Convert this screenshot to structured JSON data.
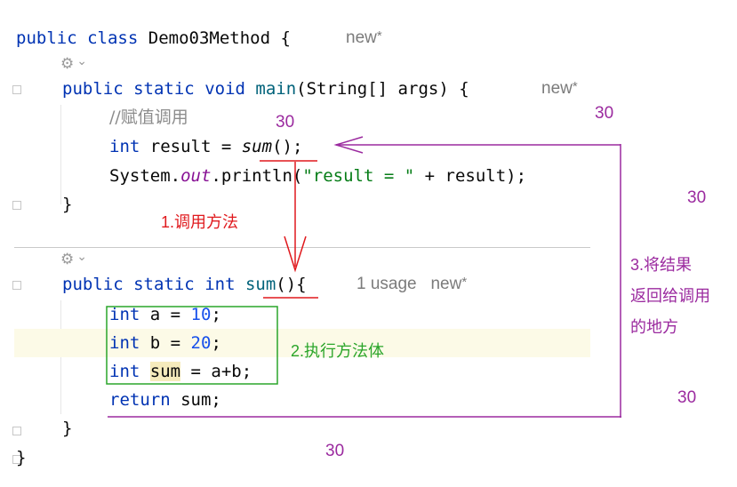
{
  "code": {
    "class_decl": {
      "public": "public",
      "class": "class",
      "name": "Demo03Method",
      "brace": "{"
    },
    "class_hint": {
      "text": "new",
      "star": "*"
    },
    "main_decl": {
      "public": "public",
      "static": "static",
      "void": "void",
      "name": "main",
      "params": "(String[] args)",
      "brace": "{"
    },
    "main_hint": {
      "text": "new",
      "star": "*"
    },
    "comment": "//赋值调用",
    "assign_line": {
      "type": "int",
      "rest1": "result = ",
      "call": "sum",
      "rest2": "();"
    },
    "println_line": {
      "cls": "System.",
      "field": "out",
      "method": ".println(",
      "str": "\"result = \"",
      "rest": " + result);"
    },
    "main_close": "}",
    "sum_decl": {
      "public": "public",
      "static": "static",
      "int": "int",
      "name": "sum",
      "rest": "(){"
    },
    "sum_hint": {
      "usage": "1 usage",
      "new": "new",
      "star": "*"
    },
    "line_a": {
      "type": "int",
      "rest": "a = ",
      "num": "10",
      "end": ";"
    },
    "line_b": {
      "type": "int",
      "rest": "b = ",
      "num": "20",
      "end": ";"
    },
    "line_sum": {
      "type": "int",
      "var": "sum",
      "rest": " = a+b;"
    },
    "return_line": {
      "kw": "return",
      "rest": " sum;"
    },
    "sum_close": "}",
    "class_close": "}"
  },
  "gutter": {
    "icon_glyph": "⚙",
    "chevron_glyph": "⌄",
    "icon_name": "ai-assist-icon"
  },
  "annotations": {
    "step1": "1.调用方法",
    "step2": "2.执行方法体",
    "step3_line1": "3.将结果",
    "step3_line2": "返回给调用",
    "step3_line3": "的地方",
    "n30_a": "30",
    "n30_b": "30",
    "n30_c": "30",
    "n30_d": "30",
    "n30_e": "30"
  },
  "colors": {
    "red": "#e0191d",
    "green": "#2aa52a",
    "purple": "#9b2a9f",
    "keyword": "#0033b3",
    "number": "#1750eb",
    "string": "#067d17"
  }
}
